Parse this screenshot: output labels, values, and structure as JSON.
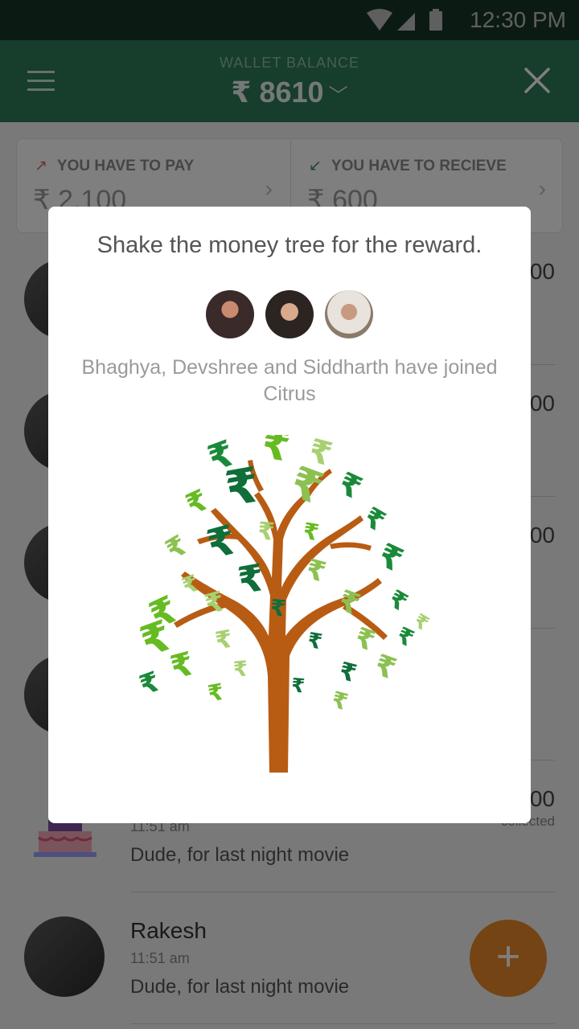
{
  "status_bar": {
    "time": "12:30 PM"
  },
  "app_bar": {
    "wallet_label": "WALLET BALANCE",
    "wallet_amount": "₹ 8610"
  },
  "summary": {
    "pay": {
      "label": "YOU HAVE TO PAY",
      "amount": "₹ 2,100"
    },
    "receive": {
      "label": "YOU HAVE TO RECIEVE",
      "amount": "₹ 600"
    }
  },
  "list": {
    "rows": [
      {
        "amount": "00"
      },
      {
        "amount": "00"
      },
      {
        "amount": "00"
      },
      {
        "amount": ""
      },
      {
        "name": "",
        "time": "11:51 am",
        "note": "Dude, for last night movie",
        "amount": "00",
        "status": "collected"
      },
      {
        "name": "Rakesh",
        "time": "11:51 am",
        "note": "Dude, for last night movie",
        "amount": ""
      }
    ]
  },
  "fab": {
    "label": "+"
  },
  "dialog": {
    "title": "Shake the money tree for the reward.",
    "joined_text": "Bhaghya, Devshree and Siddharth have joined Citrus",
    "tree_glyph": "₹"
  },
  "colors": {
    "status_bar": "#1f4a36",
    "app_bar": "#2f7a58",
    "fab": "#e8892a",
    "tree_trunk": "#b85c14",
    "leaf_greens": [
      "#1a8a3a",
      "#66bb22",
      "#a8d070",
      "#0f6e3a",
      "#8cc152"
    ]
  }
}
